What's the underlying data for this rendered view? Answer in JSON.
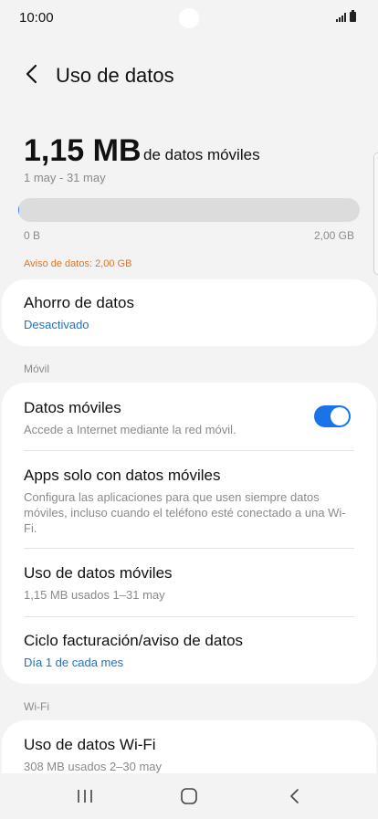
{
  "status_bar": {
    "time": "10:00"
  },
  "header": {
    "title": "Uso de datos"
  },
  "usage": {
    "amount": "1,15 MB",
    "suffix": "de datos móviles",
    "period": "1 may - 31 may",
    "bar_min": "0 B",
    "bar_max": "2,00 GB",
    "fill_fraction": 0.0006,
    "warning": "Aviso de datos: 2,00 GB"
  },
  "data_saver": {
    "title": "Ahorro de datos",
    "status": "Desactivado"
  },
  "mobile_section": {
    "label": "Móvil",
    "items": [
      {
        "title": "Datos móviles",
        "subtitle": "Accede a Internet mediante la red móvil.",
        "toggle_on": true
      },
      {
        "title": "Apps solo con datos móviles",
        "subtitle": "Configura las aplicaciones para que usen siempre datos móviles, incluso cuando el teléfono esté conectado a una Wi-Fi."
      },
      {
        "title": "Uso de datos móviles",
        "subtitle": "1,15 MB usados 1–31 may"
      },
      {
        "title": "Ciclo facturación/aviso de datos",
        "subtitle": "Día 1 de cada mes"
      }
    ]
  },
  "wifi_section": {
    "label": "Wi-Fi",
    "items": [
      {
        "title": "Uso de datos Wi-Fi",
        "subtitle": "308 MB usados 2–30 may"
      }
    ]
  },
  "colors": {
    "accent": "#1a73e8",
    "link": "#1a73c8",
    "warning": "#e0742a",
    "background": "#f3f3f3"
  },
  "icons": {
    "back": "chevron-left-icon",
    "recents": "recent-apps-icon",
    "home": "home-icon",
    "nav_back": "back-icon"
  }
}
